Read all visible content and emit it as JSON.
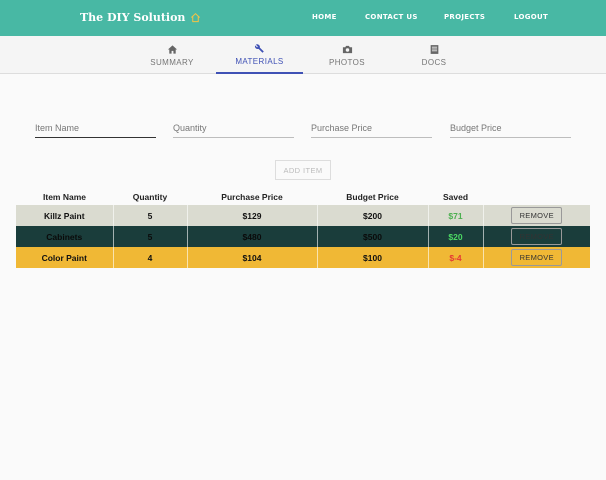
{
  "app": {
    "brand": "The DIY Solution"
  },
  "topnav": [
    "HOME",
    "CONTACT US",
    "PROJECTS",
    "LOGOUT"
  ],
  "tabs": [
    {
      "label": "SUMMARY",
      "icon": "home-icon"
    },
    {
      "label": "MATERIALS",
      "icon": "wrench-icon",
      "active": true
    },
    {
      "label": "PHOTOS",
      "icon": "camera-icon"
    },
    {
      "label": "DOCS",
      "icon": "document-icon"
    }
  ],
  "form": {
    "item_name": {
      "placeholder": "Item Name",
      "value": ""
    },
    "quantity": {
      "placeholder": "Quantity",
      "value": ""
    },
    "purchase_price": {
      "placeholder": "Purchase Price",
      "value": ""
    },
    "budget_price": {
      "placeholder": "Budget Price",
      "value": ""
    },
    "add_button": "ADD ITEM"
  },
  "table": {
    "headers": [
      "Item Name",
      "Quantity",
      "Purchase Price",
      "Budget Price",
      "Saved",
      ""
    ],
    "remove_label": "REMOVE",
    "rows": [
      {
        "name": "Killz Paint",
        "quantity": "5",
        "purchase": "$129",
        "budget": "$200",
        "saved": "$71",
        "bg": "#dadbd0",
        "text": "#111111",
        "saved_color": "#4caf50"
      },
      {
        "name": "Cabinets",
        "quantity": "5",
        "purchase": "$480",
        "budget": "$500",
        "saved": "$20",
        "bg": "#1a3d3b",
        "text": "#0a0a0a",
        "saved_color": "#4cd964"
      },
      {
        "name": "Color Paint",
        "quantity": "4",
        "purchase": "$104",
        "budget": "$100",
        "saved": "$-4",
        "bg": "#f0b835",
        "text": "#111111",
        "saved_color": "#e53935"
      }
    ]
  },
  "colors": {
    "header": "#48b8a4",
    "accent": "#3f51b5"
  }
}
